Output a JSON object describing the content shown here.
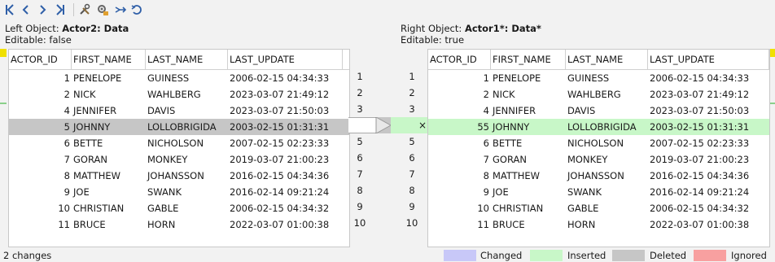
{
  "toolbar": {
    "buttons": [
      {
        "name": "first-diff-button",
        "icon": "first-diff-icon"
      },
      {
        "name": "prev-diff-button",
        "icon": "chevron-left-icon"
      },
      {
        "name": "next-diff-button",
        "icon": "chevron-right-icon"
      },
      {
        "name": "last-diff-button",
        "icon": "last-diff-icon"
      },
      {
        "name": "settings-button",
        "icon": "tools-icon"
      },
      {
        "name": "compare-settings-button",
        "icon": "gear-compare-icon"
      },
      {
        "name": "merge-button",
        "icon": "merge-arrow-icon"
      },
      {
        "name": "refresh-button",
        "icon": "refresh-icon"
      }
    ]
  },
  "left": {
    "object_prefix": "Left Object: ",
    "object_name": "Actor2: Data",
    "editable": "Editable: false"
  },
  "right": {
    "object_prefix": "Right Object: ",
    "object_name": "Actor1*: Data*",
    "editable": "Editable: true"
  },
  "columns": [
    "ACTOR_ID",
    "FIRST_NAME",
    "LAST_NAME",
    "LAST_UPDATE"
  ],
  "left_rows": [
    [
      "1",
      "PENELOPE",
      "GUINESS",
      "2006-02-15 04:34:33"
    ],
    [
      "2",
      "NICK",
      "WAHLBERG",
      "2023-03-07 21:49:12"
    ],
    [
      "4",
      "JENNIFER",
      "DAVIS",
      "2023-03-07 21:50:03"
    ],
    [
      "5",
      "JOHNNY",
      "LOLLOBRIGIDA",
      "2003-02-15 01:31:31"
    ],
    [
      "6",
      "BETTE",
      "NICHOLSON",
      "2007-02-15 02:23:33"
    ],
    [
      "7",
      "GORAN",
      "MONKEY",
      "2019-03-07 21:00:23"
    ],
    [
      "8",
      "MATTHEW",
      "JOHANSSON",
      "2016-02-15 04:34:36"
    ],
    [
      "9",
      "JOE",
      "SWANK",
      "2016-02-14 09:21:24"
    ],
    [
      "10",
      "CHRISTIAN",
      "GABLE",
      "2006-02-15 04:34:32"
    ],
    [
      "11",
      "BRUCE",
      "HORN",
      "2022-03-07 01:00:38"
    ]
  ],
  "right_rows": [
    [
      "1",
      "PENELOPE",
      "GUINESS",
      "2006-02-15 04:34:33"
    ],
    [
      "2",
      "NICK",
      "WAHLBERG",
      "2023-03-07 21:49:12"
    ],
    [
      "4",
      "JENNIFER",
      "DAVIS",
      "2023-03-07 21:50:03"
    ],
    [
      "55",
      "JOHNNY",
      "LOLLOBRIGIDA",
      "2003-02-15 01:31:31"
    ],
    [
      "6",
      "BETTE",
      "NICHOLSON",
      "2007-02-15 02:23:33"
    ],
    [
      "7",
      "GORAN",
      "MONKEY",
      "2019-03-07 21:00:23"
    ],
    [
      "8",
      "MATTHEW",
      "JOHANSSON",
      "2016-02-15 04:34:36"
    ],
    [
      "9",
      "JOE",
      "SWANK",
      "2016-02-14 09:21:24"
    ],
    [
      "10",
      "CHRISTIAN",
      "GABLE",
      "2006-02-15 04:34:32"
    ],
    [
      "11",
      "BRUCE",
      "HORN",
      "2022-03-07 01:00:38"
    ]
  ],
  "row_states_left": [
    "",
    "",
    "",
    "deleted",
    "",
    "",
    "",
    "",
    "",
    ""
  ],
  "row_states_right": [
    "",
    "",
    "",
    "inserted",
    "",
    "",
    "",
    "",
    "",
    ""
  ],
  "left_line_numbers": [
    "1",
    "2",
    "3",
    "4",
    "5",
    "6",
    "7",
    "8",
    "9",
    "10"
  ],
  "right_line_numbers": [
    "1",
    "2",
    "3",
    "4",
    "5",
    "6",
    "7",
    "8",
    "9",
    "10"
  ],
  "revert_glyph": "×",
  "status": "2 changes",
  "legend": [
    {
      "label": "Changed",
      "color": "#c8c8f8"
    },
    {
      "label": "Inserted",
      "color": "#c8f7c8"
    },
    {
      "label": "Deleted",
      "color": "#c6c6c6"
    },
    {
      "label": "Ignored",
      "color": "#f8a0a0"
    }
  ],
  "colors": {
    "accent": "#2f5fa8",
    "inserted": "#c8f7c8",
    "deleted": "#c6c6c6",
    "marker_yellow": "#f0e000"
  }
}
